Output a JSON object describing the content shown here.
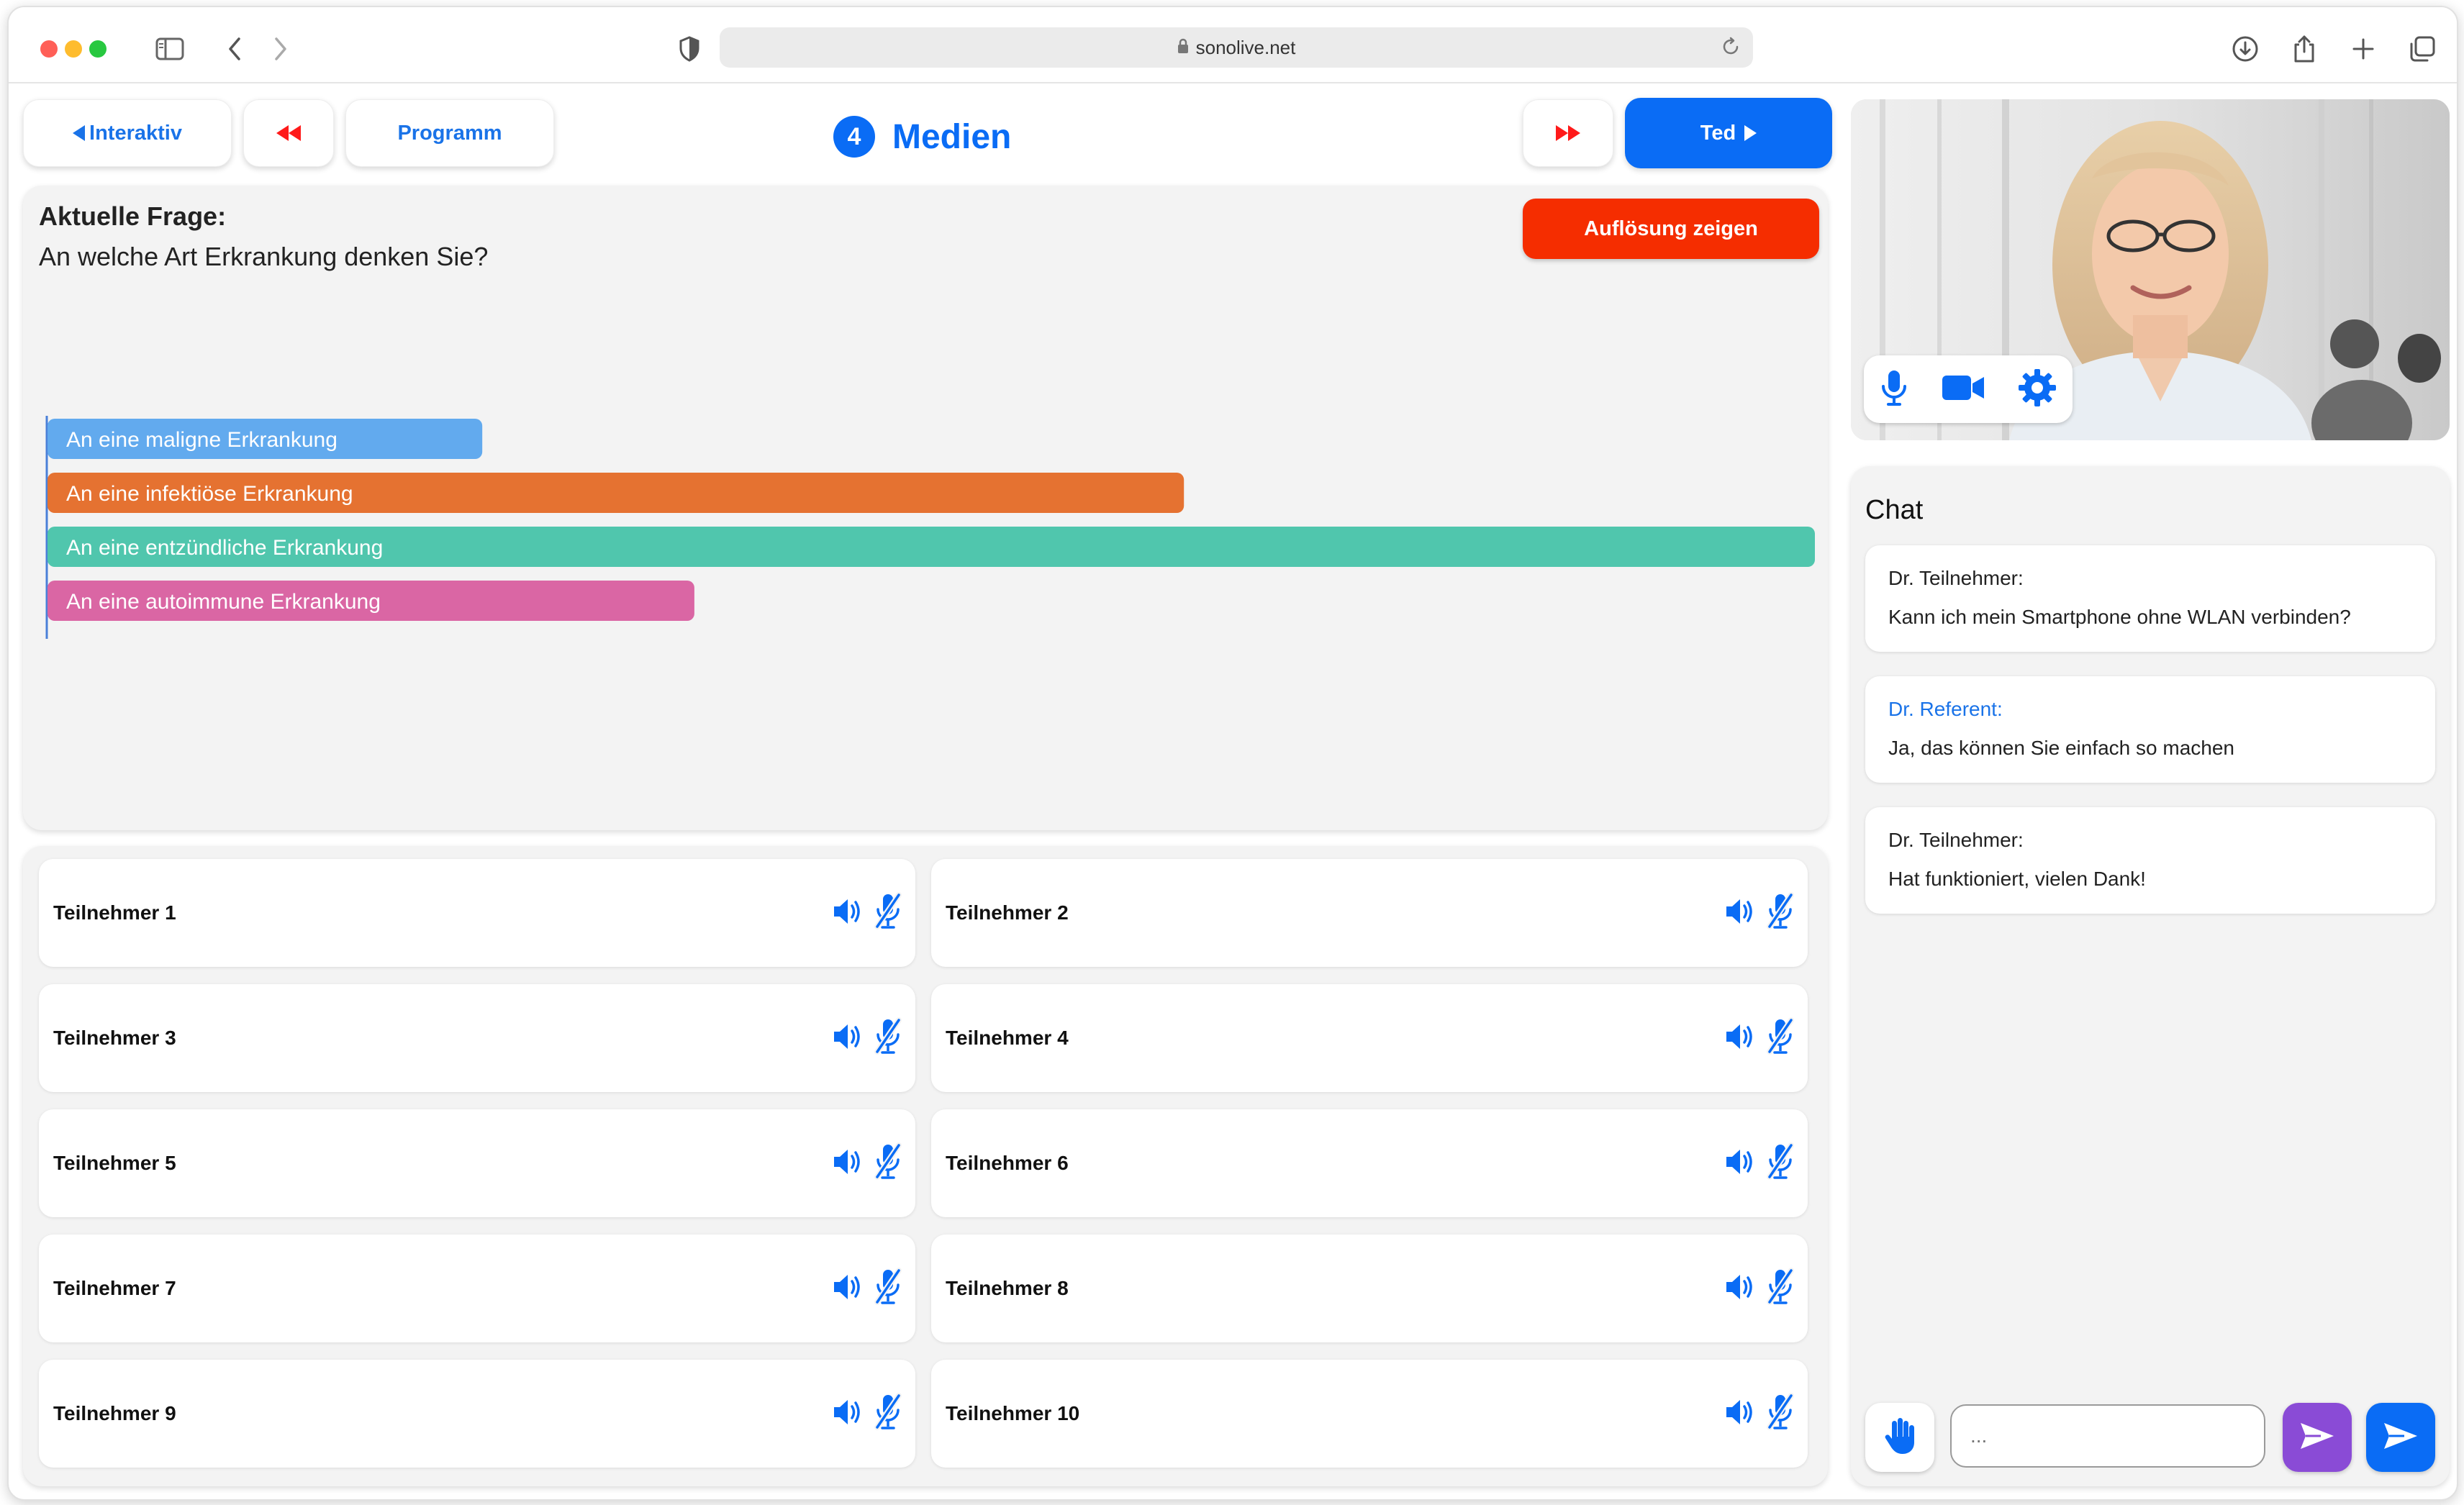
{
  "browser": {
    "url": "sonolive.net"
  },
  "nav": {
    "interaktiv_label": "Interaktiv",
    "programm_label": "Programm",
    "ted_label": "Ted",
    "section_number": "4",
    "section_name": "Medien"
  },
  "question": {
    "label": "Aktuelle Frage:",
    "text": "An welche Art Erkrankung denken Sie?",
    "reveal_label": "Auflösung zeigen"
  },
  "chart_data": {
    "type": "bar",
    "orientation": "horizontal",
    "categories": [
      "An eine maligne Erkrankung",
      "An eine infektiöse Erkrankung",
      "An eine entzündliche Erkrankung",
      "An eine autoimmune Erkrankung"
    ],
    "values": [
      24.6,
      64.3,
      100,
      36.6
    ],
    "colors": [
      "#62aaee",
      "#e57231",
      "#50c6ad",
      "#da66a4"
    ],
    "xlim": [
      0,
      100
    ]
  },
  "participants": [
    {
      "name": "Teilnehmer 1"
    },
    {
      "name": "Teilnehmer 2"
    },
    {
      "name": "Teilnehmer 3"
    },
    {
      "name": "Teilnehmer 4"
    },
    {
      "name": "Teilnehmer 5"
    },
    {
      "name": "Teilnehmer 6"
    },
    {
      "name": "Teilnehmer 7"
    },
    {
      "name": "Teilnehmer 8"
    },
    {
      "name": "Teilnehmer 9"
    },
    {
      "name": "Teilnehmer 10"
    }
  ],
  "chat": {
    "title": "Chat",
    "messages": [
      {
        "author": "Dr. Teilnehmer:",
        "text": "Kann ich mein Smartphone ohne WLAN verbinden?"
      },
      {
        "author": "Dr. Referent:",
        "text": "Ja, das können Sie einfach so machen"
      },
      {
        "author": "Dr. Teilnehmer:",
        "text": "Hat funktioniert, vielen Dank!"
      }
    ],
    "input_placeholder": "..."
  },
  "colors": {
    "accent": "#0a6cf5",
    "reveal": "#f52d00",
    "purple_send": "#8a4bd6"
  },
  "icons": {
    "speaker": "speaker-icon",
    "mic_off": "mic-off-icon",
    "mic": "mic-icon",
    "camera": "camera-icon",
    "settings": "gear-icon",
    "hand": "hand-icon",
    "send": "send-icon"
  }
}
